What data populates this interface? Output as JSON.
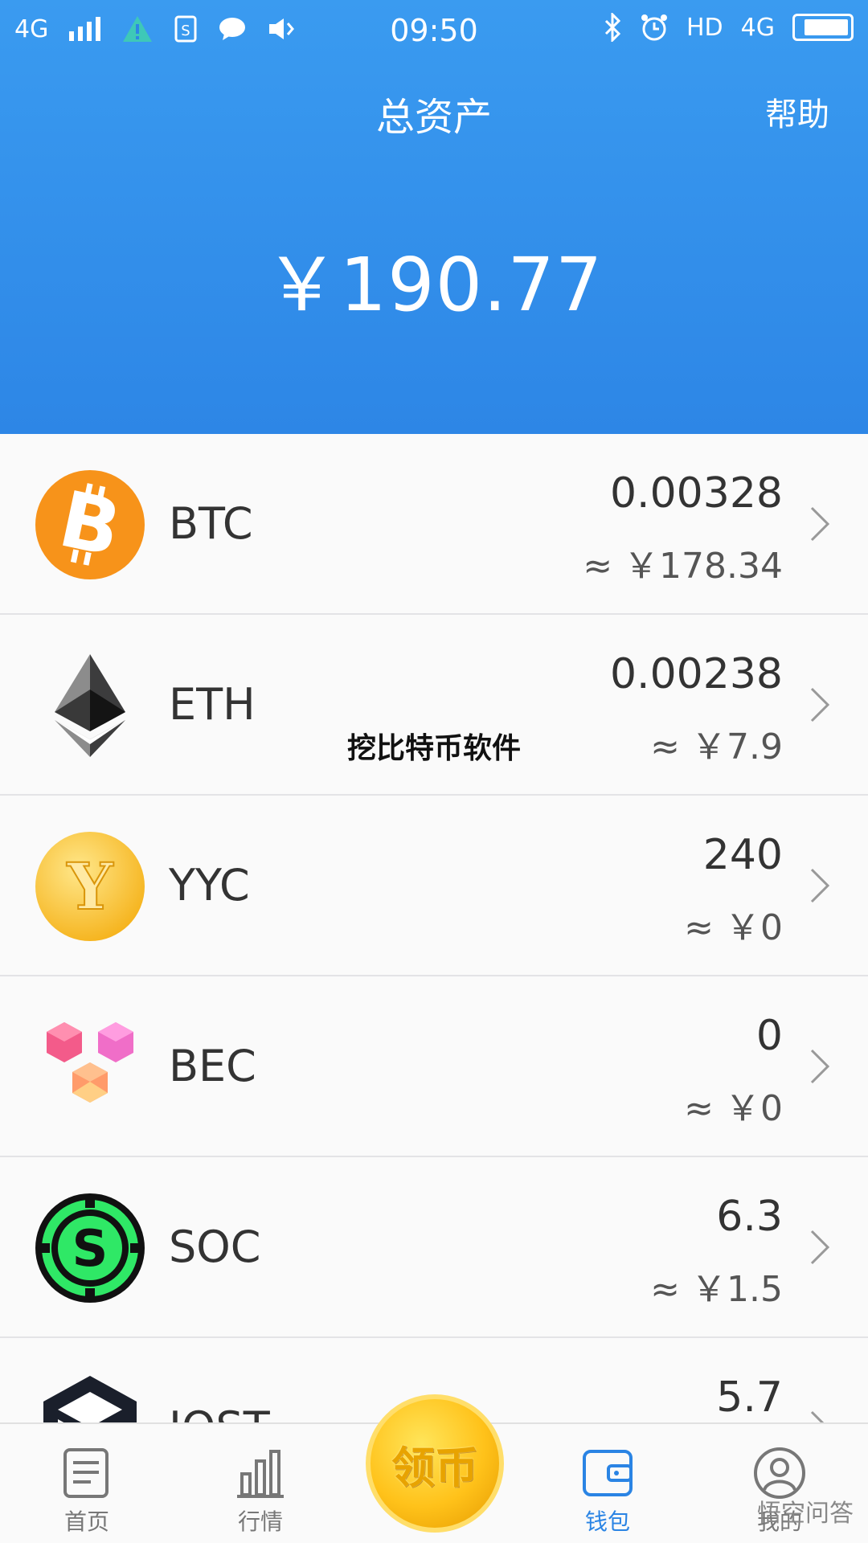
{
  "status_bar": {
    "network_left": "4G",
    "time": "09:50",
    "hd_label": "HD",
    "network_right": "4G"
  },
  "header": {
    "title": "总资产",
    "help_label": "帮助",
    "total_assets": "￥190.77",
    "background_color": "#3a9bf0"
  },
  "coins": [
    {
      "symbol": "BTC",
      "amount": "0.00328",
      "value": "≈ ￥178.34",
      "icon": "bitcoin-icon"
    },
    {
      "symbol": "ETH",
      "amount": "0.00238",
      "value": "≈ ￥7.9",
      "icon": "ethereum-icon"
    },
    {
      "symbol": "YYC",
      "amount": "240",
      "value": "≈ ￥0",
      "icon": "yyc-coin-icon"
    },
    {
      "symbol": "BEC",
      "amount": "0",
      "value": "≈ ￥0",
      "icon": "bec-cubes-icon"
    },
    {
      "symbol": "SOC",
      "amount": "6.3",
      "value": "≈ ￥1.5",
      "icon": "soc-dollar-icon"
    },
    {
      "symbol": "IOST",
      "amount": "5.7",
      "value": "",
      "icon": "iost-icon"
    }
  ],
  "overlay_caption": "挖比特币软件",
  "tabbar": {
    "home_label": "首页",
    "market_label": "行情",
    "claim_label": "领币",
    "wallet_label": "钱包",
    "mine_label": "我的",
    "active_color": "#2a84e4"
  },
  "brand_watermark": "悟空问答"
}
